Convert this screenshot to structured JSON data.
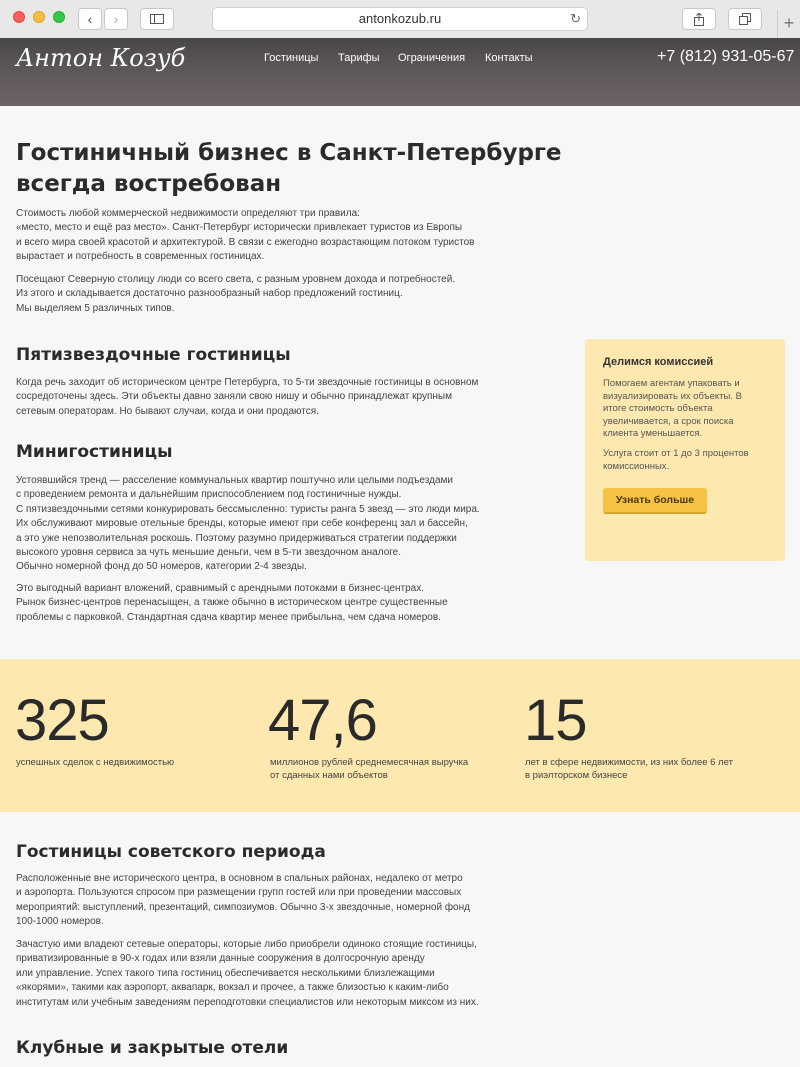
{
  "browser": {
    "url": "antonkozub.ru",
    "back_icon": "chevron-left-icon",
    "forward_icon": "chevron-right-icon",
    "sidebar_icon": "sidebar-icon",
    "reload_icon": "reload-icon",
    "share_icon": "share-icon",
    "tabs_icon": "tabs-icon",
    "new_tab_icon": "plus-icon"
  },
  "header": {
    "logo": "Антон Козуб",
    "nav": [
      "Гостиницы",
      "Тарифы",
      "Ограничения",
      "Контакты"
    ],
    "phone": "+7 (812) 931-05-67"
  },
  "intro": {
    "title": "Гостиничный бизнес в Санкт-Петербурге\nвсегда востребован",
    "p1": "Стоимость любой коммерческой недвижимости определяют три правила:\n«место, место и ещё раз место». Санкт-Петербург исторически привлекает туристов из Европы\nи всего мира своей красотой и архитектурой. В связи с ежегодно возрастающим потоком туристов\nвырастает и потребность в современных гостиницах.",
    "p2": "Посещают Северную столицу люди со всего света, с разным уровнем дохода и потребностей.\nИз этого и складывается достаточно разнообразный набор предложений гостиниц.\nМы выделяем 5 различных типов."
  },
  "five_star": {
    "title": "Пятизвездочные гостиницы",
    "p1": "Когда речь заходит об историческом центре Петербурга, то 5-ти звездочные гостиницы в основном\nсосредоточены здесь. Эти объекты давно заняли свою нишу и обычно принадлежат крупным\nсетевым операторам. Но бывают случаи, когда и они продаются."
  },
  "mini": {
    "title": "Минигостиницы",
    "p1": "Устоявшийся тренд — расселение коммунальных квартир поштучно или целыми подъездами\nс проведением ремонта и дальнейшим приспособлением под гостиничные нужды.\nС пятизвездочными сетями конкурировать бессмысленно: туристы ранга 5 звезд — это люди мира.\nИх обслуживают мировые отельные бренды, которые имеют при себе конференц зал и бассейн,\nа это уже непозволительная роскошь. Поэтому разумно придерживаться стратегии поддержки\nвысокого уровня сервиса за чуть меньшие деньги, чем в 5-ти звездочном аналоге.\nОбычно номерной фонд до 50 номеров, категории 2-4 звезды.",
    "p2": "Это выгодный вариант вложений, сравнимый с арендными потоками в бизнес-центрах.\nРынок бизнес-центров перенасыщен, а также обычно в историческом центре существенные\nпроблемы с парковкой. Стандартная сдача квартир менее прибыльна, чем сдача номеров."
  },
  "sidebox": {
    "title": "Делимся комиссией",
    "p1": "Помогаем агентам упаковать и\nвизуализировать их объекты. В\nитоге стоимость объекта\nувеличивается, а срок поиска\nклиента уменьшается.",
    "p2": "Услуга стоит от 1 до 3 процентов\nкомиссионных.",
    "button": "Узнать больше"
  },
  "stats": [
    {
      "value": "325",
      "caption": "успешных сделок с недвижимостью"
    },
    {
      "value": "47,6",
      "caption": "миллионов рублей среднемесячная выручка\nот сданных нами объектов"
    },
    {
      "value": "15",
      "caption": "лет в сфере недвижимости, из них более 6 лет\nв риэлторском бизнесе"
    }
  ],
  "soviet": {
    "title": "Гостиницы советского периода",
    "p1": "Расположенные вне исторического центра, в основном в спальных районах, недалеко от метро\nи аэропорта. Пользуются спросом при размещении групп гостей или при проведении массовых\nмероприятий: выступлений, презентаций, симпозиумов. Обычно 3-х звездочные, номерной фонд\n100-1000 номеров.",
    "p2": "Зачастую ими владеют сетевые операторы, которые либо приобрели одиноко стоящие гостиницы,\nприватизированные в 90-х годах или взяли данные сооружения в долгосрочную аренду\nили управление. Успех такого типа гостиниц обеспечивается несколькими близлежащими\n«якорями», такими как аэропорт, аквапарк, вокзал и прочее, а также близостью к каким-либо\nинститутам или учебным заведениям переподготовки специалистов или некоторым миксом из них."
  },
  "club": {
    "title": "Клубные и закрытые отели"
  }
}
